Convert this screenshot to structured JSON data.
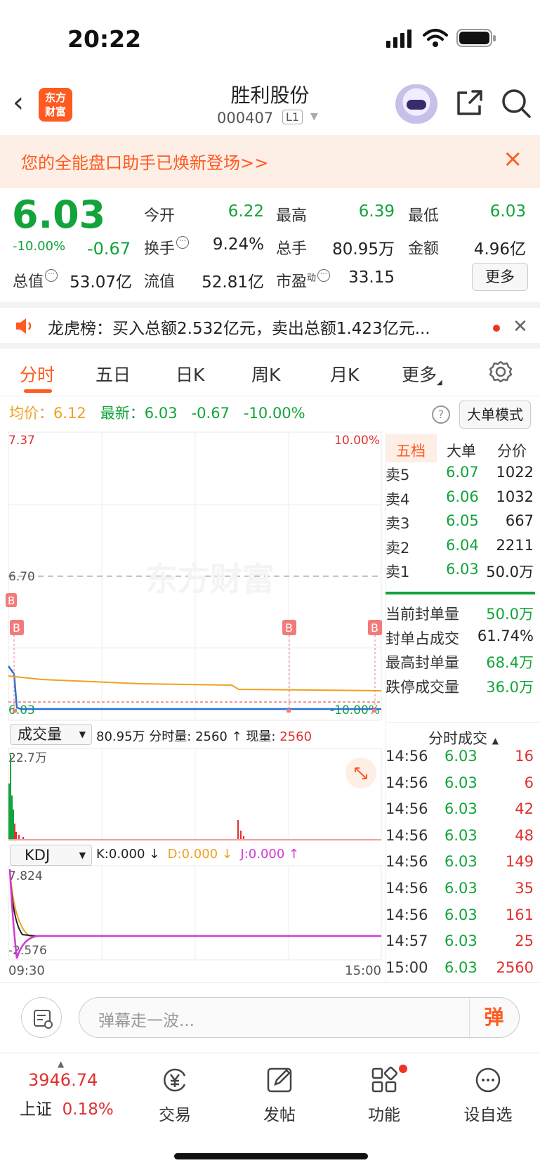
{
  "status_bar": {
    "time": "20:22"
  },
  "header": {
    "logo_line1": "东方",
    "logo_line2": "财富",
    "stock_name": "胜利股份",
    "stock_code": "000407",
    "level_tag": "L1"
  },
  "banner": {
    "text": "您的全能盘口助手已焕新登场>>"
  },
  "quote": {
    "price": "6.03",
    "change_pct": "-10.00%",
    "change": "-0.67",
    "open_label": "今开",
    "open": "6.22",
    "high_label": "最高",
    "high": "6.39",
    "low_label": "最低",
    "low": "6.03",
    "turnover_label": "换手",
    "turnover": "9.24%",
    "volume_label": "总手",
    "volume": "80.95万",
    "amount_label": "金额",
    "amount": "4.96亿",
    "mktcap_label": "总值",
    "mktcap": "53.07亿",
    "float_label": "流值",
    "float_cap": "52.81亿",
    "pe_label": "市盈",
    "pe_sup": "动",
    "pe": "33.15",
    "more_label": "更多"
  },
  "dragon_tiger": {
    "text": "龙虎榜：买入总额2.532亿元，卖出总额1.423亿元..."
  },
  "tabs": [
    "分时",
    "五日",
    "日K",
    "周K",
    "月K",
    "更多"
  ],
  "line_info": {
    "avg_label": "均价：",
    "avg": "6.12",
    "latest_label": "最新：",
    "latest": "6.03",
    "change": "-0.67",
    "change_pct": "-10.00%",
    "big_order_mode": "大单模式"
  },
  "price_chart": {
    "y_top": "7.37",
    "y_mid": "6.70",
    "y_bottom": "6.03",
    "pct_top": "10.00%",
    "pct_bottom": "-10.00%",
    "watermark": "东方财富",
    "markers": [
      "B",
      "B",
      "B",
      "B"
    ]
  },
  "order_book": {
    "tabs": [
      "五档",
      "大单",
      "分价"
    ],
    "asks": [
      {
        "label": "卖5",
        "price": "6.07",
        "vol": "1022"
      },
      {
        "label": "卖4",
        "price": "6.06",
        "vol": "1032"
      },
      {
        "label": "卖3",
        "price": "6.05",
        "vol": "667"
      },
      {
        "label": "卖2",
        "price": "6.04",
        "vol": "2211"
      },
      {
        "label": "卖1",
        "price": "6.03",
        "vol": "50.0万"
      }
    ],
    "seal": [
      {
        "label": "当前封单量",
        "value": "50.0万"
      },
      {
        "label": "封单占成交",
        "value": "61.74%"
      },
      {
        "label": "最高封单量",
        "value": "68.4万"
      },
      {
        "label": "跌停成交量",
        "value": "36.0万"
      }
    ]
  },
  "volume": {
    "selector": "成交量",
    "info_total": "80.95万",
    "info_period_label": "分时量:",
    "info_period": "2560",
    "info_now_label": "现量:",
    "info_now": "2560",
    "y_max": "22.7万"
  },
  "kdj": {
    "selector": "KDJ",
    "k": "K:0.000",
    "d": "D:0.000",
    "j": "J:0.000",
    "y_max": "7.824",
    "y_min": "-2.576",
    "x_start": "09:30",
    "x_end": "15:00"
  },
  "ticks": {
    "header": "分时成交",
    "rows": [
      {
        "time": "14:56",
        "price": "6.03",
        "vol": "16"
      },
      {
        "time": "14:56",
        "price": "6.03",
        "vol": "6"
      },
      {
        "time": "14:56",
        "price": "6.03",
        "vol": "42"
      },
      {
        "time": "14:56",
        "price": "6.03",
        "vol": "48"
      },
      {
        "time": "14:56",
        "price": "6.03",
        "vol": "149"
      },
      {
        "time": "14:56",
        "price": "6.03",
        "vol": "35"
      },
      {
        "time": "14:56",
        "price": "6.03",
        "vol": "161"
      },
      {
        "time": "14:57",
        "price": "6.03",
        "vol": "25"
      },
      {
        "time": "15:00",
        "price": "6.03",
        "vol": "2560"
      }
    ]
  },
  "comment": {
    "placeholder": "弹幕走一波...",
    "danmu_label": "弹"
  },
  "nav": {
    "index_value": "3946.74",
    "index_name": "上证",
    "index_pct": "0.18%",
    "items": [
      "交易",
      "发帖",
      "功能",
      "设自选"
    ]
  }
}
